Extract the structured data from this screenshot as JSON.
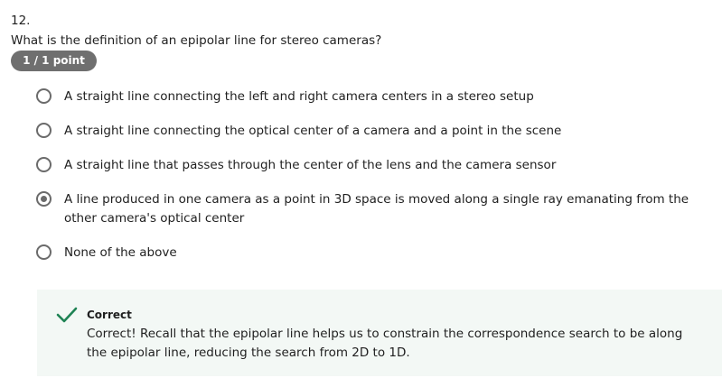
{
  "question": {
    "number": "12.",
    "text": "What is the definition of an epipolar line for stereo cameras?",
    "points": "1 / 1 point"
  },
  "options": [
    {
      "label": "A straight line connecting the left and right camera centers in a stereo setup",
      "selected": false
    },
    {
      "label": "A straight line connecting the optical center of a camera and a point in the scene",
      "selected": false
    },
    {
      "label": "A straight line that passes through the center of the lens and the camera sensor",
      "selected": false
    },
    {
      "label": "A line produced in one camera as a point in 3D space is moved along a single ray emanating from the other camera's optical center",
      "selected": true
    },
    {
      "label": "None of the above",
      "selected": false
    }
  ],
  "feedback": {
    "icon": "check-icon",
    "title": "Correct",
    "text": "Correct! Recall that the epipolar line helps us to constrain the correspondence search to be along the epipolar line, reducing the search from 2D to 1D.",
    "accent_color": "#1f8354",
    "background_color": "#f3f8f5"
  }
}
